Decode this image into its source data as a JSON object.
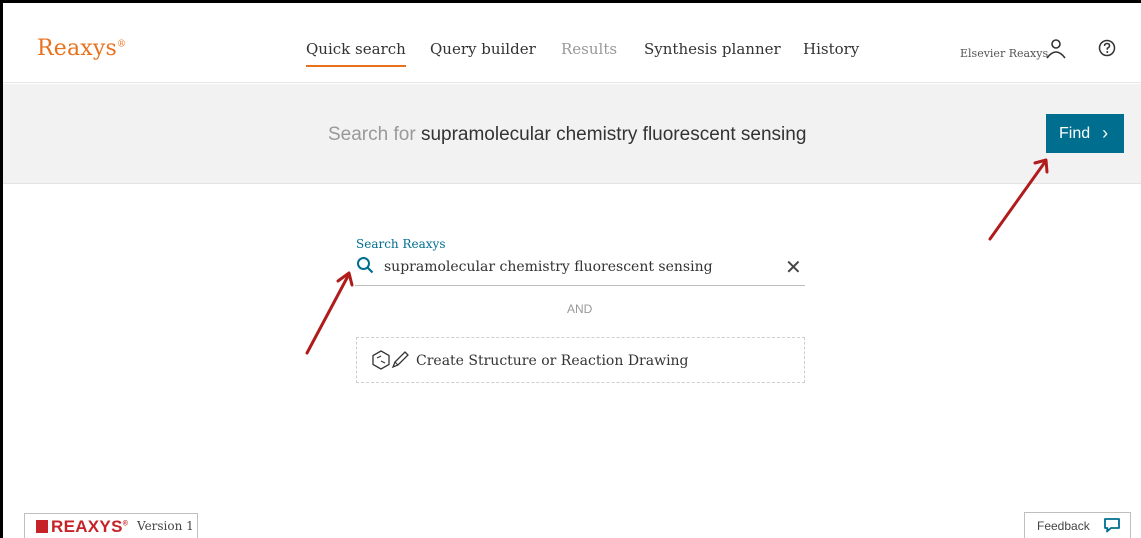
{
  "app": {
    "logo": "Reaxys"
  },
  "nav": {
    "items": [
      {
        "label": "Quick search",
        "state": "active"
      },
      {
        "label": "Query builder",
        "state": "normal"
      },
      {
        "label": "Results",
        "state": "disabled"
      },
      {
        "label": "Synthesis planner",
        "state": "normal"
      },
      {
        "label": "History",
        "state": "normal"
      }
    ]
  },
  "user": {
    "name": "Elsevier Reaxys",
    "icon": "user-icon",
    "help_icon": "help-icon"
  },
  "search_band": {
    "prefix": "Search for",
    "query": "supramolecular chemistry fluorescent sensing",
    "find_label": "Find",
    "find_chevron": "›"
  },
  "search": {
    "label": "Search Reaxys",
    "value": "supramolecular chemistry fluorescent sensing",
    "clear_glyph": "✕",
    "and_label": "AND",
    "draw_label": "Create Structure or Reaction Drawing"
  },
  "footer": {
    "brand": "REAXYS",
    "version": "Version 1",
    "feedback": "Feedback"
  },
  "colors": {
    "accent": "#e9711c",
    "primary": "#006e8f",
    "annotation_arrow": "#b01c1c",
    "brand_red": "#c52327"
  }
}
